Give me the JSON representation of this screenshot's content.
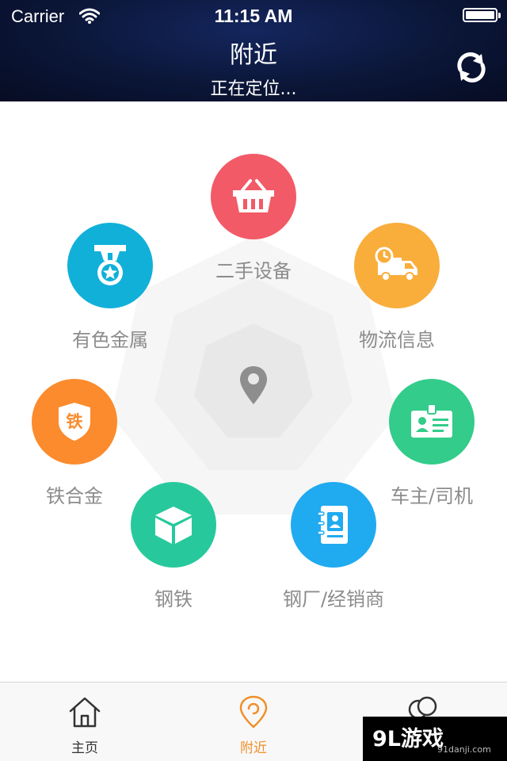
{
  "status_bar": {
    "carrier": "Carrier",
    "time": "11:15 AM"
  },
  "header": {
    "title": "附近",
    "subtitle": "正在定位..."
  },
  "center": {
    "icon": "location-pin-icon"
  },
  "menu_items": [
    {
      "label": "二手设备",
      "icon": "basket-icon",
      "color": "#f25a67"
    },
    {
      "label": "物流信息",
      "icon": "delivery-truck-icon",
      "color": "#f9ad3b"
    },
    {
      "label": "车主/司机",
      "icon": "id-card-icon",
      "color": "#33cc8a"
    },
    {
      "label": "钢厂/经销商",
      "icon": "address-book-icon",
      "color": "#20aaf0"
    },
    {
      "label": "钢铁",
      "icon": "cube-icon",
      "color": "#27c99c"
    },
    {
      "label": "铁合金",
      "icon": "shield-iron-icon",
      "color": "#fb8b2d",
      "badge_text": "铁"
    },
    {
      "label": "有色金属",
      "icon": "medal-icon",
      "color": "#11b0d9"
    }
  ],
  "tabbar": {
    "active_color": "#f0902a",
    "inactive_color": "#333333",
    "tabs": [
      {
        "label": "主页",
        "icon": "home-icon",
        "active": false
      },
      {
        "label": "附近",
        "icon": "location-icon",
        "active": true
      },
      {
        "label": "",
        "icon": "chat-icon",
        "active": false
      }
    ]
  },
  "watermark": {
    "logo": "9L游戏",
    "url": "91danji.com"
  }
}
